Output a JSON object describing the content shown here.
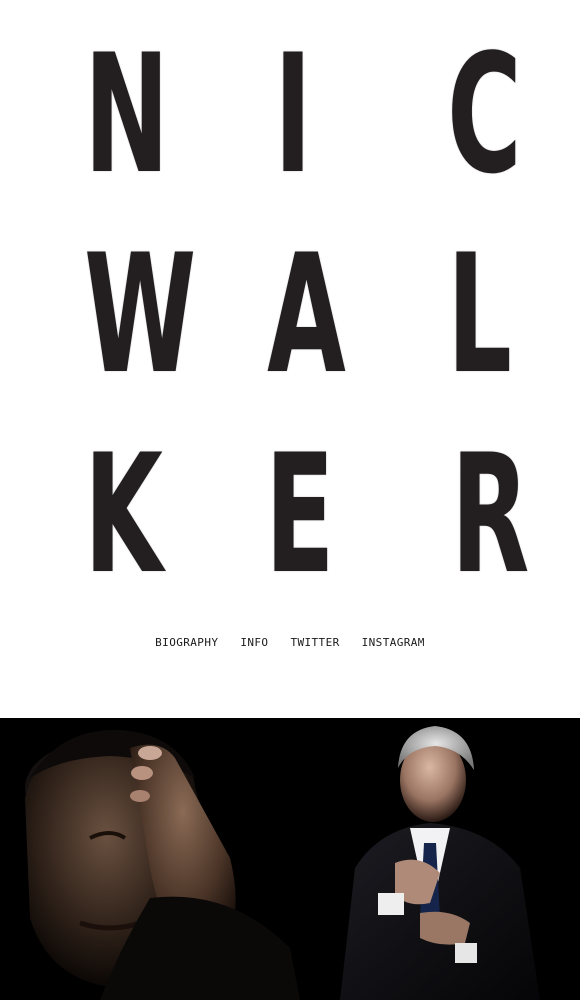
{
  "logo": {
    "rows": [
      [
        "N",
        "I",
        "C"
      ],
      [
        "W",
        "A",
        "L"
      ],
      [
        "K",
        "E",
        "R"
      ]
    ]
  },
  "nav": {
    "items": [
      {
        "label": "BIOGRAPHY"
      },
      {
        "label": "INFO"
      },
      {
        "label": "TWITTER"
      },
      {
        "label": "INSTAGRAM"
      }
    ]
  },
  "colors": {
    "background": "#ffffff",
    "letters": "#231f20",
    "photo_background": "#000000"
  }
}
